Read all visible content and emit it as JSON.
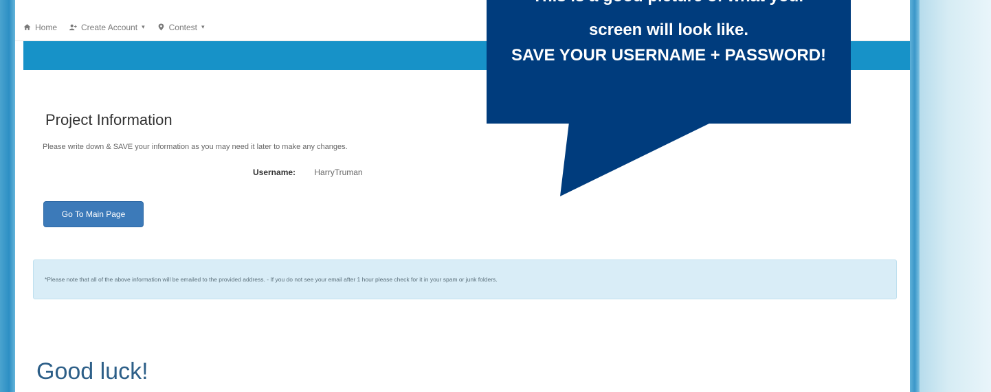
{
  "nav": {
    "home": "Home",
    "create_account": "Create Account",
    "contest": "Contest"
  },
  "project": {
    "title": "Project Information",
    "note": "Please write down & SAVE your information as you may need it later to make any changes.",
    "username_label": "Username:",
    "username_value": "HarryTruman"
  },
  "button": {
    "main_page": "Go To Main Page"
  },
  "alert": {
    "text": "*Please note that all of the above information will be emailed to the provided address. - If you do not see your email after 1 hour please check for it in your spam or junk folders."
  },
  "goodluck": "Good luck!",
  "callout": {
    "line0": "This is a good picture of what your",
    "line1": "screen will look like.",
    "line2": "SAVE YOUR USERNAME + PASSWORD!"
  },
  "colors": {
    "callout": "#003c7d",
    "band": "#1792c8",
    "button": "#3c7ab9",
    "alert": "#d9edf7"
  }
}
